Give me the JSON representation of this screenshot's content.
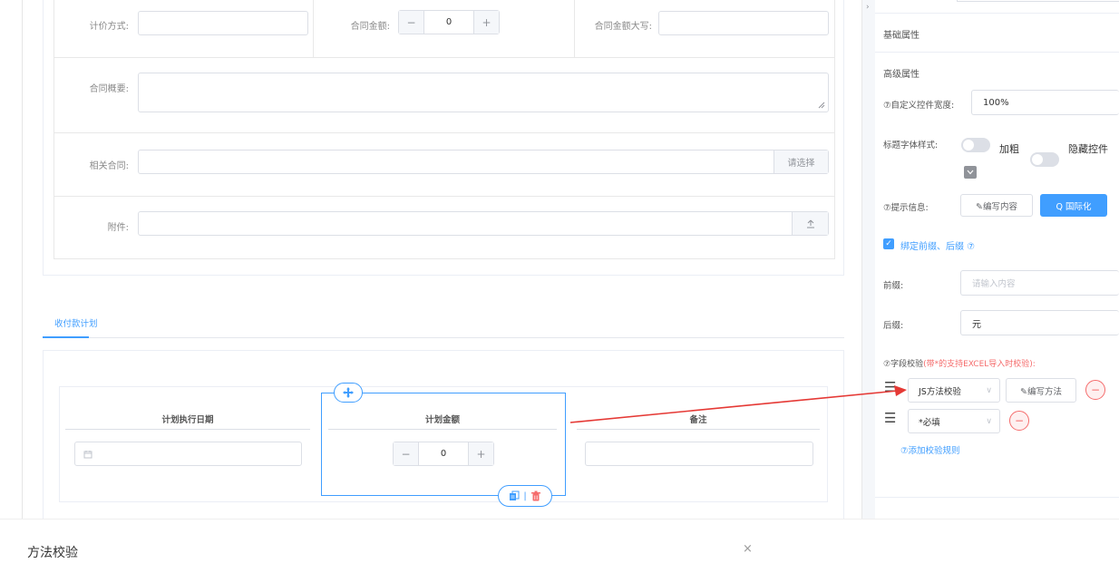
{
  "form": {
    "pricing_method_label": "计价方式:",
    "contract_amount_label": "合同金额:",
    "contract_amount_value": "0",
    "contract_amount_caps_label": "合同金额大写:",
    "contract_summary_label": "合同概要:",
    "related_contract_label": "相关合同:",
    "related_contract_button": "请选择",
    "attachment_label": "附件:",
    "upload_icon": "upload-icon"
  },
  "tab": {
    "label": "收付款计划"
  },
  "plan_table": {
    "columns": [
      "计划执行日期",
      "计划金额",
      "备注"
    ],
    "amount_value": "0",
    "move_icon": "move-icon",
    "copy_icon": "copy-icon",
    "delete_icon": "delete-icon",
    "separator": "|"
  },
  "settings": {
    "basic_props": "基础属性",
    "advanced_props": "高级属性",
    "custom_width_label": "⑦自定义控件宽度:",
    "custom_width_value": "100%",
    "title_font_label": "标题字体样式:",
    "bold_label": "加粗",
    "hide_label": "隐藏控件",
    "hint_label": "⑦提示信息:",
    "edit_content_button": "✎编写内容",
    "i18n_button": "Q 国际化",
    "bind_prefix_suffix_label": "绑定前缀、后缀 ⑦",
    "prefix_label": "前缀:",
    "prefix_placeholder": "请输入内容",
    "suffix_label": "后缀:",
    "suffix_value": "元",
    "validation_label_prefix": "⑦字段校验",
    "validation_label_note": "(带*的支持EXCEL导入时校验):",
    "rules": [
      {
        "type": "JS方法校验",
        "action": "✎编写方法"
      },
      {
        "type": "*必填"
      }
    ],
    "add_rule": "⑦添加校验规则"
  },
  "dialog": {
    "title": "方法校验",
    "close": "×"
  },
  "colors": {
    "primary": "#409eff",
    "danger": "#f56c6c",
    "arrow": "#e53935"
  }
}
